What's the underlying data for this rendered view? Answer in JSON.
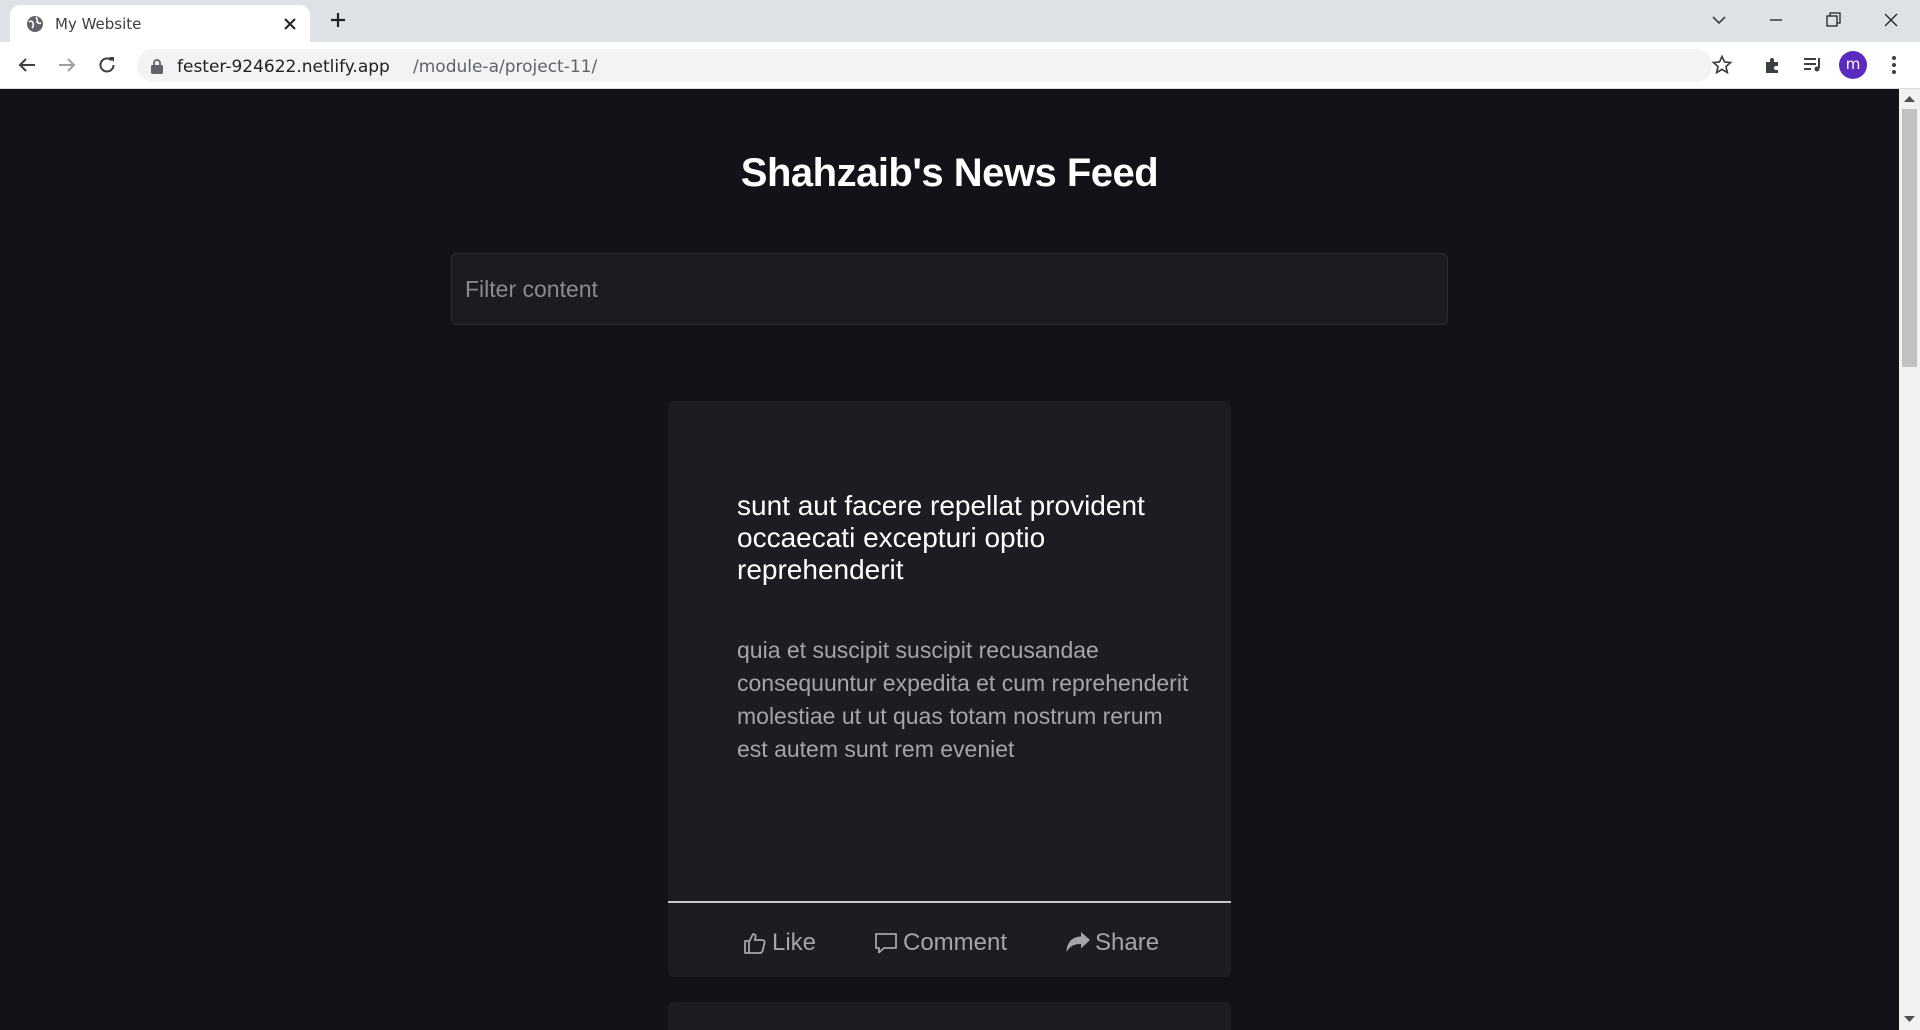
{
  "browser": {
    "tab": {
      "title": "My Website"
    },
    "address": {
      "host": "fester-924622.netlify.app",
      "path": "/module-a/project-11/"
    },
    "profile": {
      "initial": "m",
      "color": "#5b2bbf"
    }
  },
  "page": {
    "title": "Shahzaib's News Feed",
    "filter": {
      "placeholder": "Filter content",
      "value": ""
    },
    "posts": [
      {
        "title": "sunt aut facere repellat provident occaecati excepturi optio reprehenderit",
        "body": "quia et suscipit suscipit recusandae consequuntur expedita et cum reprehenderit molestiae ut ut quas totam nostrum rerum est autem sunt rem eveniet",
        "actions": {
          "like": "Like",
          "comment": "Comment",
          "share": "Share"
        }
      }
    ]
  },
  "colors": {
    "background": "#121319",
    "card": "#1c1d23",
    "muted_text": "#a4a5ab"
  },
  "icons": {
    "tab": "globe-icon",
    "close": "close-icon",
    "new_tab": "plus-icon",
    "like": "thumbs-up-icon",
    "comment": "comment-icon",
    "share": "share-icon"
  }
}
